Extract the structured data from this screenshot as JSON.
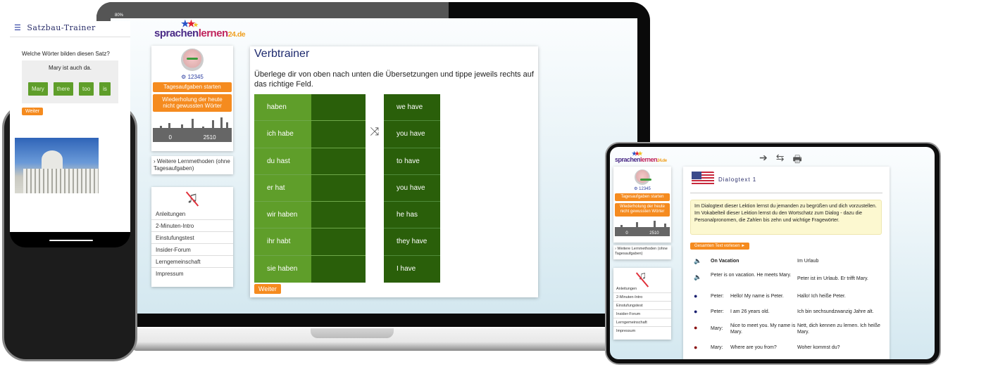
{
  "brand": {
    "logo_part1": "sprachen",
    "logo_part2": "lernen",
    "logo_part3": "24.de"
  },
  "sidebar": {
    "points": "⚙ 12345",
    "daily_tasks_button": "Tagesaufgaben starten",
    "review_button": "Wiederholung der heute nicht gewussten Wörter",
    "score_min": "0",
    "score_max": "2510",
    "more_methods": "› Weitere Lernmethoden (ohne Tagesaufgaben)",
    "menu": [
      "Anleitungen",
      "2-Minuten-Intro",
      "Einstufungstest",
      "Insider-Forum",
      "Lerngemeinschaft",
      "Impressum"
    ]
  },
  "verbtrainer": {
    "title": "Verbtrainer",
    "instructions": "Überlege dir von oben nach unten die Übersetzungen und tippe jeweils rechts auf das richtige Feld.",
    "german": [
      "haben",
      "ich habe",
      "du hast",
      "er hat",
      "wir haben",
      "ihr habt",
      "sie haben"
    ],
    "english": [
      "we have",
      "you have",
      "to have",
      "you have",
      "he has",
      "they have",
      "I have"
    ],
    "next_button": "Weiter"
  },
  "phone": {
    "status_right": "80%",
    "title": "Satzbau-Trainer",
    "question": "Welche Wörter bilden diesen Satz?",
    "sentence": "Mary ist auch da.",
    "chips": [
      "Mary",
      "there",
      "too",
      "is"
    ],
    "next_button": "Weiter"
  },
  "tablet": {
    "dialog_title": "Dialogtext 1",
    "info_line1": "Im Dialogtext dieser Lektion lernst du jemanden zu begrüßen und dich vorzustellen.",
    "info_line2": "Im Vokabelteil dieser Lektion lernst du den Wortschatz zum Dialog - dazu die Personalpronomen, die Zahlen bis zehn und wichtige Fragewörter.",
    "read_all_button": "Gesamten Text vorlesen ►",
    "rows": [
      {
        "speaker": "",
        "en": "On Vacation",
        "de": "Im Urlaub"
      },
      {
        "speaker": "",
        "en": "Peter is on vacation. He meets Mary.",
        "de": "Peter ist im Urlaub. Er trifft Mary."
      },
      {
        "speaker": "Peter:",
        "en": "Hello! My name is Peter.",
        "de": "Hallo! Ich heiße Peter."
      },
      {
        "speaker": "Peter:",
        "en": "I am 26 years old.",
        "de": "Ich bin sechsundzwanzig Jahre alt."
      },
      {
        "speaker": "Mary:",
        "en": "Nice to meet you. My name is Mary.",
        "de": "Nett, dich kennen zu lernen. Ich heiße Mary."
      },
      {
        "speaker": "Mary:",
        "en": "Where are you from?",
        "de": "Woher kommst du?"
      }
    ]
  },
  "colors": {
    "accent_orange": "#f58b1f",
    "green_light": "#5f9e2a",
    "green_dark": "#2a5f0a",
    "title_blue": "#1e2a6e"
  }
}
